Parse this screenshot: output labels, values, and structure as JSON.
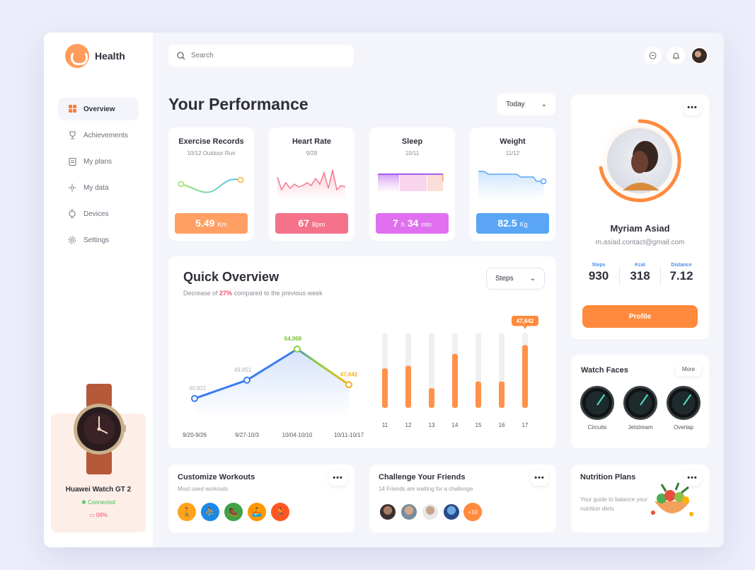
{
  "app": {
    "name": "Health"
  },
  "sidebar": {
    "items": [
      {
        "label": "Overview",
        "icon": "grid-icon",
        "active": true
      },
      {
        "label": "Achievements",
        "icon": "trophy-icon",
        "active": false
      },
      {
        "label": "My plans",
        "icon": "clipboard-icon",
        "active": false
      },
      {
        "label": "My data",
        "icon": "data-icon",
        "active": false
      },
      {
        "label": "Devices",
        "icon": "watch-icon",
        "active": false
      },
      {
        "label": "Settings",
        "icon": "gear-icon",
        "active": false
      }
    ],
    "device": {
      "name": "Huawei Watch GT 2",
      "status": "Connected",
      "battery": "06%"
    }
  },
  "header": {
    "search_placeholder": "Search"
  },
  "performance": {
    "title": "Your Performance",
    "period": "Today",
    "cards": [
      {
        "title": "Exercise Records",
        "subtitle": "10/12 Outdoor Run",
        "value": "5.49",
        "unit": "Km",
        "color": "#ff9f63"
      },
      {
        "title": "Heart Rate",
        "subtitle": "9/28",
        "value": "67",
        "unit": "Bpm",
        "color": "#f4728a"
      },
      {
        "title": "Sleep",
        "subtitle": "10/11",
        "value_h": "7",
        "unit_h": "h",
        "value_m": "34",
        "unit_m": "min",
        "color": "#e070f0"
      },
      {
        "title": "Weight",
        "subtitle": "11/12",
        "value": "82.5",
        "unit": "Kg",
        "color": "#5aa6f5"
      }
    ]
  },
  "quick_overview": {
    "title": "Quick Overview",
    "subtitle_prefix": "Decrease of",
    "subtitle_pct": "27%",
    "subtitle_suffix": "compared to the previous week",
    "metric": "Steps"
  },
  "chart_data": [
    {
      "type": "line",
      "categories": [
        "9/20-9/26",
        "9/27-10/3",
        "10/04-10/10",
        "10/11-10/17"
      ],
      "values": [
        40922,
        49851,
        64968,
        47642
      ],
      "labels": [
        "40,922",
        "49,851",
        "64,968",
        "47,642"
      ]
    },
    {
      "type": "bar",
      "categories": [
        "11",
        "12",
        "13",
        "14",
        "15",
        "16",
        "17"
      ],
      "values": [
        30000,
        32000,
        15000,
        41000,
        20000,
        20000,
        47642
      ],
      "max": 57000,
      "highlight_label": "47,642"
    }
  ],
  "profile": {
    "name": "Myriam Asiad",
    "email": "m.asiad.contact@gmail.com",
    "stats": [
      {
        "label": "Steps",
        "value": "930"
      },
      {
        "label": "Kcal",
        "value": "318"
      },
      {
        "label": "Distance",
        "value": "7.12"
      }
    ],
    "button": "Profile"
  },
  "watch_faces": {
    "title": "Watch Faces",
    "more": "More",
    "faces": [
      "Circuits",
      "Jetstream",
      "Overlap"
    ]
  },
  "workouts": {
    "title": "Customize Workouts",
    "subtitle": "Most used workouts",
    "icons": [
      {
        "name": "walk-icon",
        "color": "#ffa31a"
      },
      {
        "name": "treadmill-icon",
        "color": "#1e88e5"
      },
      {
        "name": "hike-icon",
        "color": "#43a047"
      },
      {
        "name": "rowing-icon",
        "color": "#ff9800"
      },
      {
        "name": "run-icon",
        "color": "#ff5722"
      }
    ]
  },
  "friends": {
    "title": "Challenge Your Friends",
    "subtitle": "14 Friends are waiting for a challenge",
    "more_count": "+10"
  },
  "nutrition": {
    "title": "Nutrition Plans",
    "subtitle": "Your guide to balance your nutrition diets"
  }
}
